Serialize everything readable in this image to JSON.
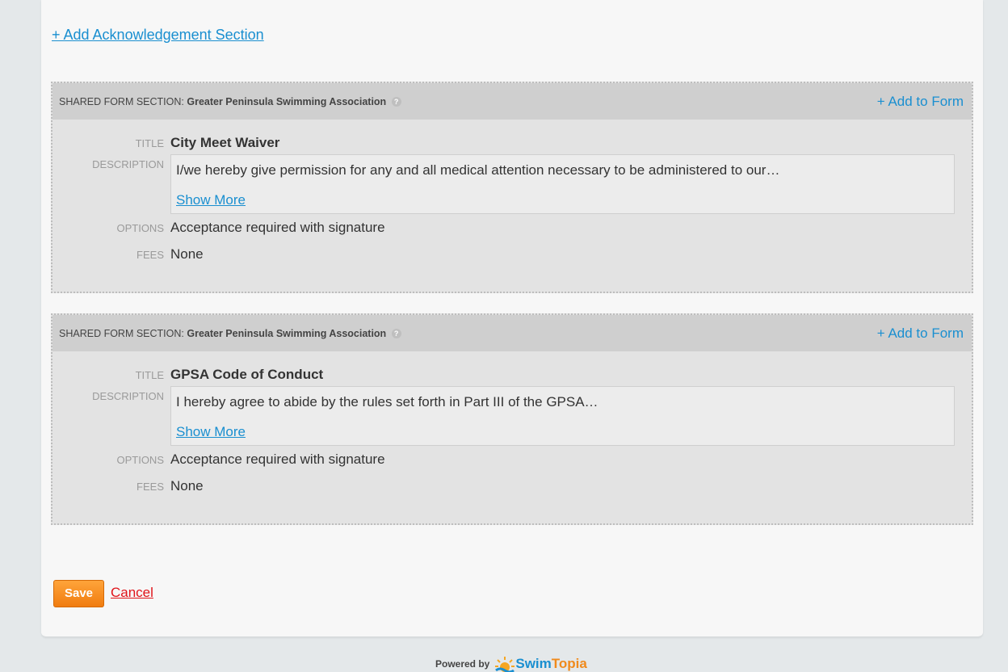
{
  "add_ack_link": "+ Add Acknowledgement Section",
  "sections": [
    {
      "header_prefix": "SHARED FORM SECTION:",
      "header_org": "Greater Peninsula Swimming Association",
      "add_to_form": "+ Add to Form",
      "title_label": "TITLE",
      "title": "City Meet Waiver",
      "description_label": "DESCRIPTION",
      "description": "I/we hereby give permission for any and all medical attention necessary to be administered to our…",
      "show_more": "Show More",
      "options_label": "OPTIONS",
      "options": "Acceptance required with signature",
      "fees_label": "FEES",
      "fees": "None"
    },
    {
      "header_prefix": "SHARED FORM SECTION:",
      "header_org": "Greater Peninsula Swimming Association",
      "add_to_form": "+ Add to Form",
      "title_label": "TITLE",
      "title": "GPSA Code of Conduct",
      "description_label": "DESCRIPTION",
      "description": "I hereby agree to abide by the rules set forth in Part III of the GPSA…",
      "show_more": "Show More",
      "options_label": "OPTIONS",
      "options": "Acceptance required with signature",
      "fees_label": "FEES",
      "fees": "None"
    }
  ],
  "actions": {
    "save": "Save",
    "cancel": "Cancel"
  },
  "footer": {
    "powered_by": "Powered by",
    "logo_swim": "Swim",
    "logo_topia": "Topia"
  },
  "colors": {
    "link": "#1a8fd0",
    "save": "#f58a1f",
    "cancel": "#e0141a"
  }
}
